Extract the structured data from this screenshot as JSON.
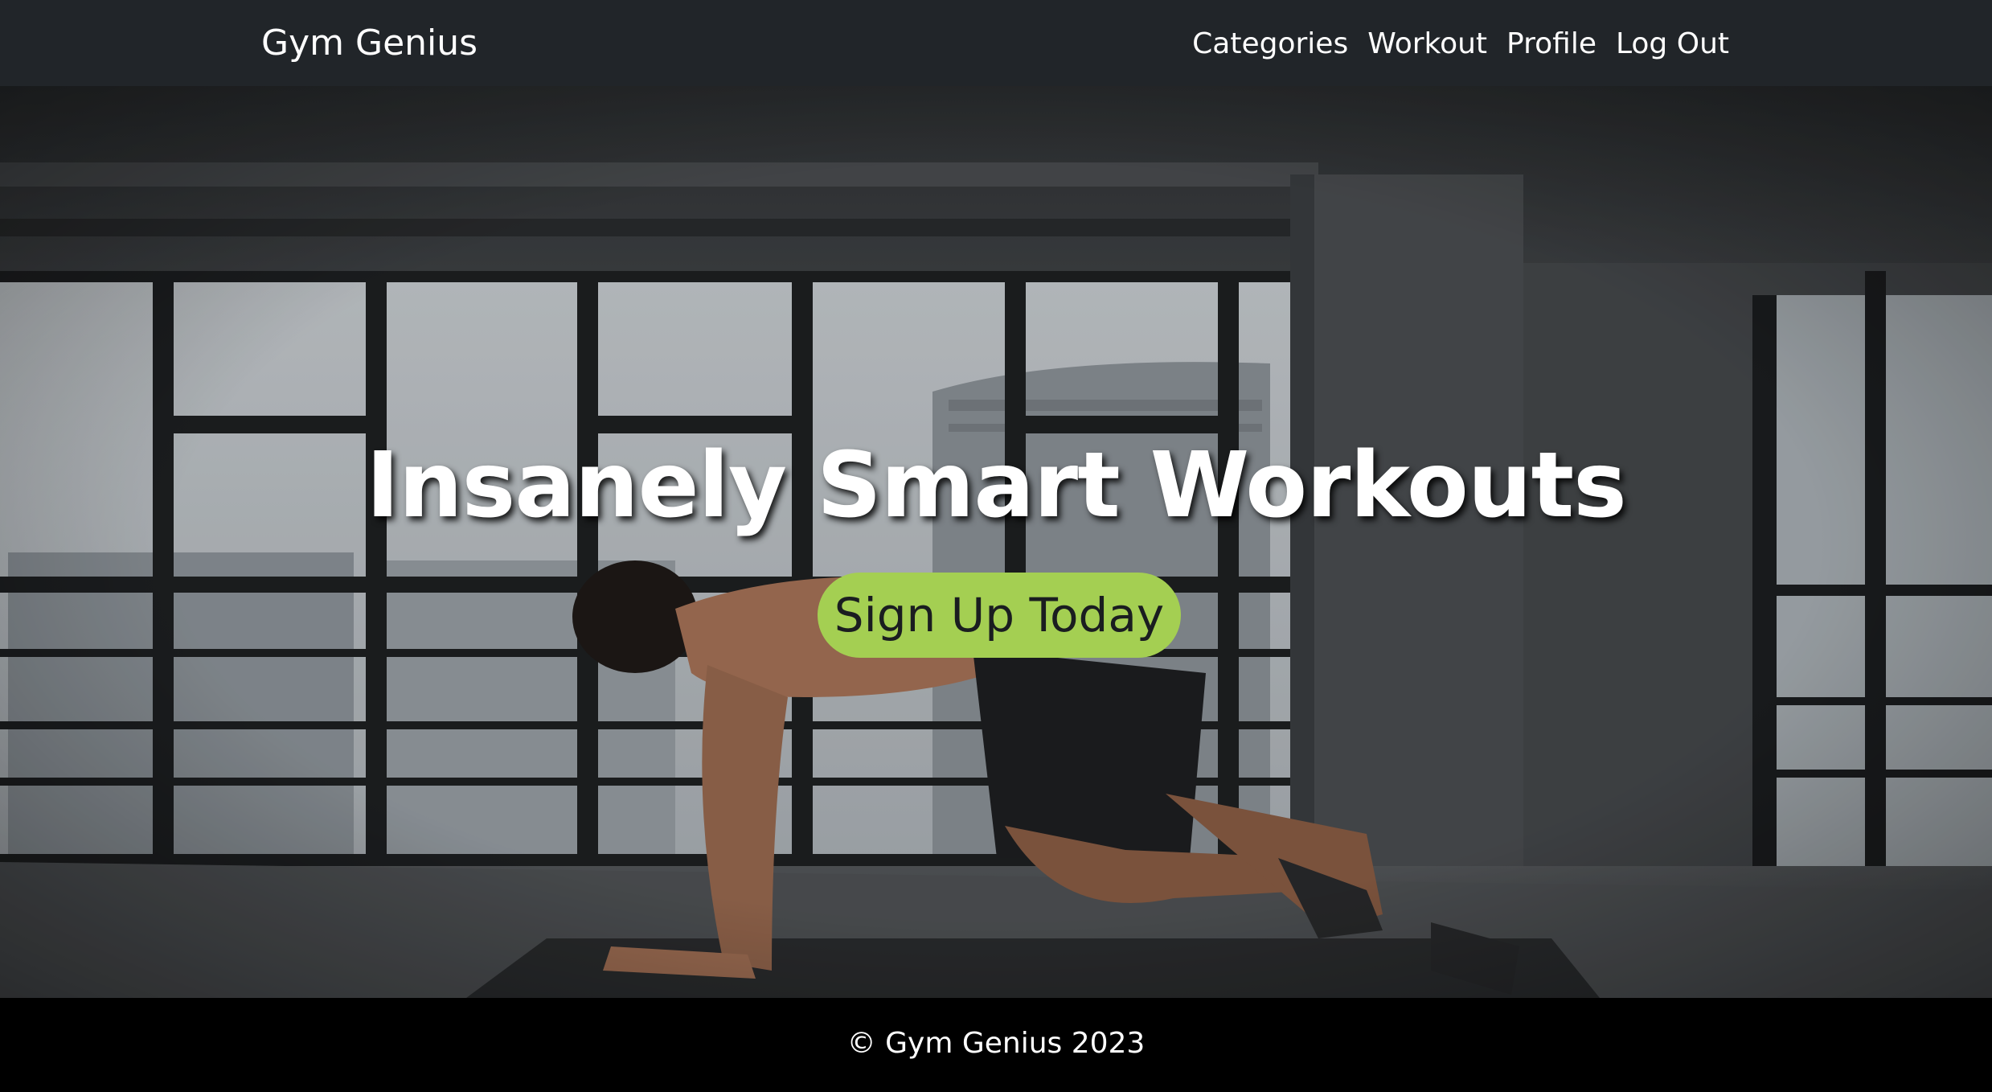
{
  "navbar": {
    "brand": "Gym Genius",
    "links": [
      {
        "label": "Categories"
      },
      {
        "label": "Workout"
      },
      {
        "label": "Profile"
      },
      {
        "label": "Log Out"
      }
    ],
    "background": "#212529"
  },
  "hero": {
    "title": "Insanely Smart Workouts",
    "cta_label": "Sign Up Today",
    "cta_color": "#a4cf52"
  },
  "footer": {
    "text": "© Gym Genius 2023"
  }
}
